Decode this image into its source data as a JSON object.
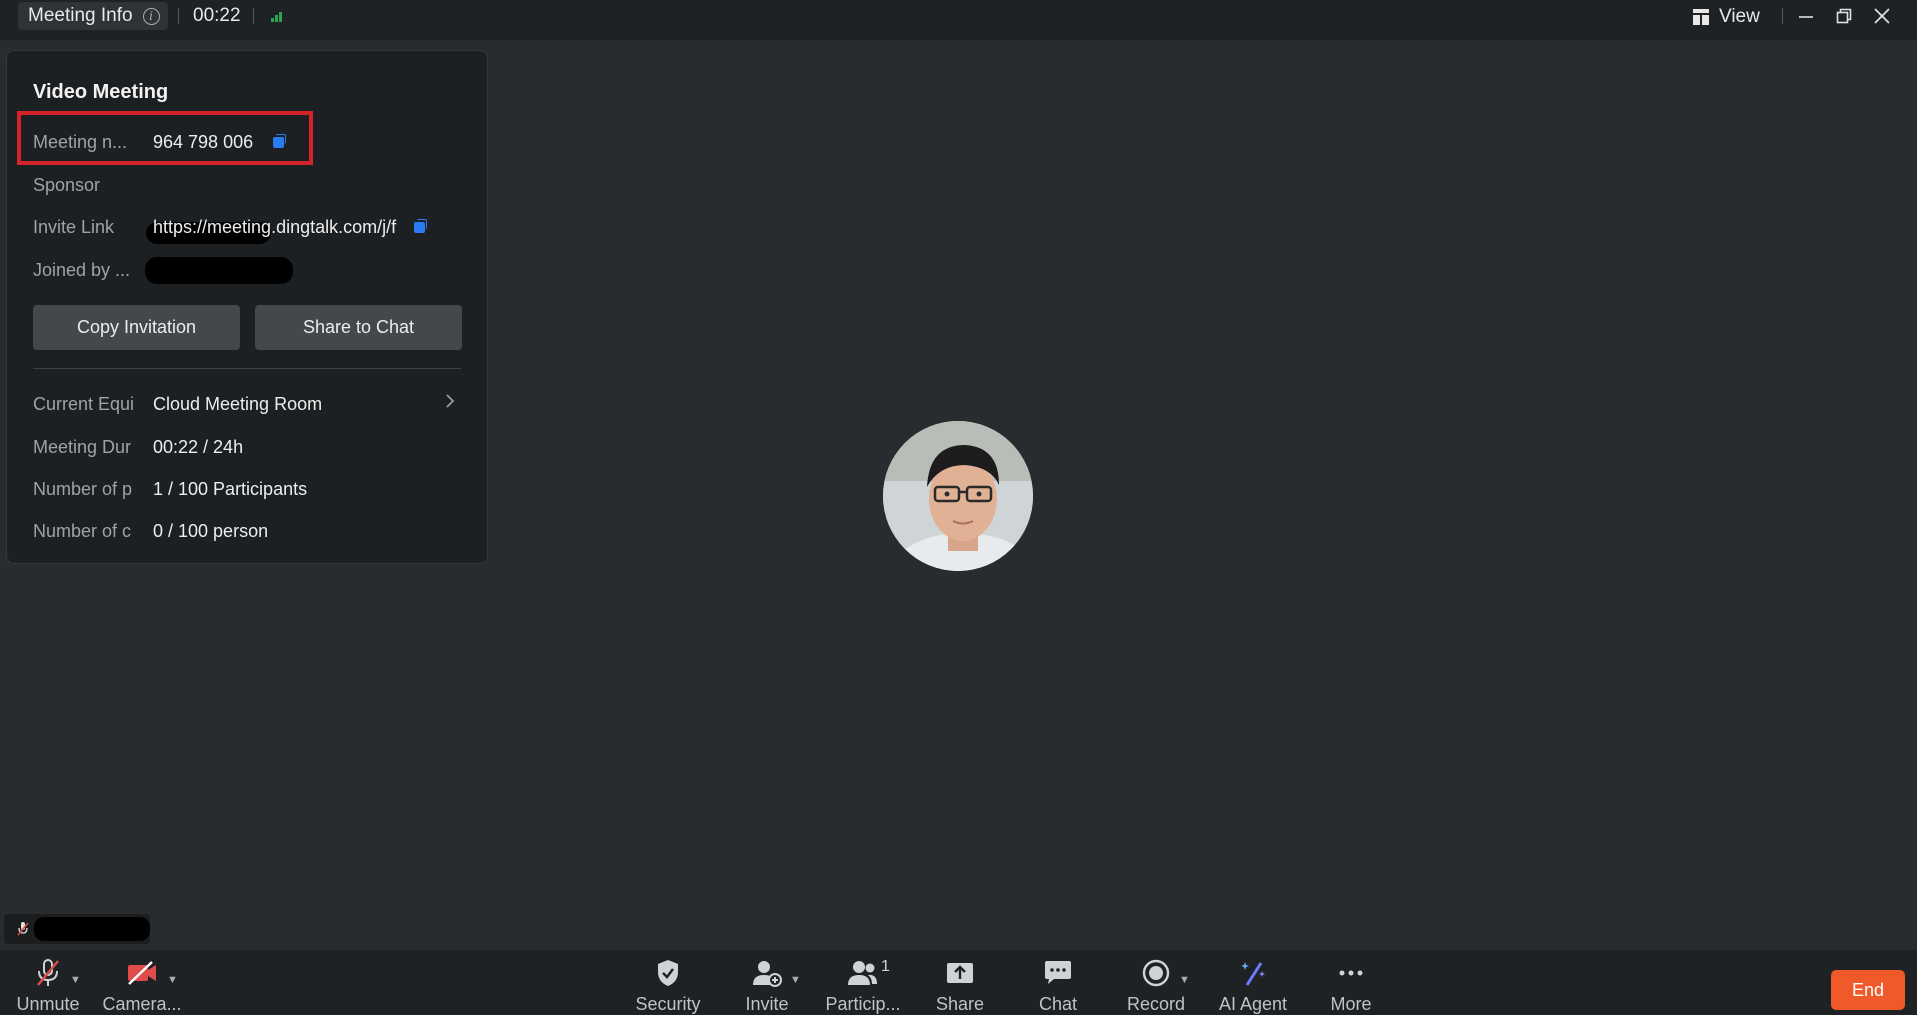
{
  "topbar": {
    "meeting_info_label": "Meeting Info",
    "timer": "00:22",
    "view_label": "View"
  },
  "panel": {
    "title": "Video Meeting",
    "rows": [
      {
        "label": "Meeting n...",
        "value": "964 798 006"
      },
      {
        "label": "Sponsor",
        "value": ""
      },
      {
        "label": "Invite Link",
        "value": "https://meeting.dingtalk.com/j/f"
      },
      {
        "label": "Joined by ...",
        "value": ""
      }
    ],
    "copy_invitation": "Copy Invitation",
    "share_to_chat": "Share to Chat",
    "details": [
      {
        "label": "Current Equi",
        "value": "Cloud Meeting Room"
      },
      {
        "label": "Meeting Dur",
        "value": "00:22 / 24h"
      },
      {
        "label": "Number of p",
        "value": "1 / 100 Participants"
      },
      {
        "label": "Number of c",
        "value": "0 / 100 person"
      }
    ]
  },
  "toolbar": {
    "unmute": "Unmute",
    "camera": "Camera...",
    "security": "Security",
    "invite": "Invite",
    "participants": "Particip...",
    "participants_count": "1",
    "share": "Share",
    "chat": "Chat",
    "record": "Record",
    "ai_agent": "AI Agent",
    "more": "More",
    "end": "End"
  },
  "colors": {
    "background": "#282c2e",
    "accent_blue": "#2a7cf0",
    "end_button": "#f0592a",
    "highlight_red": "#d4232b",
    "signal_green": "#2ea44f"
  }
}
